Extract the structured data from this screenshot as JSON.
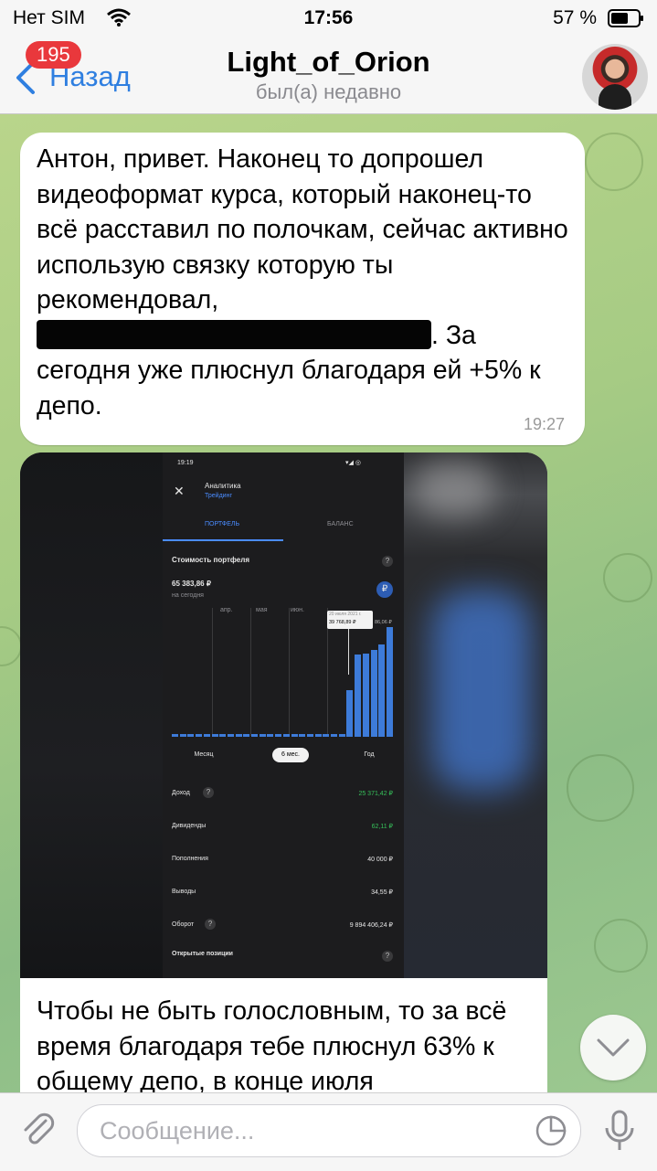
{
  "status_bar": {
    "carrier": "Нет SIM",
    "time": "17:56",
    "battery": "57 %"
  },
  "header": {
    "back_label": "Назад",
    "unread_badge": "195",
    "chat_title": "Light_of_Orion",
    "chat_status": "был(а) недавно"
  },
  "messages": [
    {
      "text_before": "Антон, привет. Наконец то допрошел видеоформат курса, который наконец-то всё расставил по полочкам, сейчас активно использую связку которую ты рекомендовал,",
      "text_after": ". За сегодня уже плюснул благодаря ей +5% к депо.",
      "time": "19:27"
    },
    {
      "caption": "Чтобы не быть голословным, то за всё время благодаря тебе плюснул 63% к общему депо, в конце июля"
    }
  ],
  "screenshot": {
    "time": "19:19",
    "title": "Аналитика",
    "subtitle": "Трейдинг",
    "tabs": [
      "ПОРТФЕЛЬ",
      "БАЛАНС"
    ],
    "section_title": "Стоимость портфеля",
    "portfolio_value": "65 383,86 ₽",
    "value_caption": "на сегодня",
    "currency_symbol": "₽",
    "month_labels": [
      "апр.",
      "мая",
      "июн."
    ],
    "tooltip_date": "20 июля 2021 г.",
    "tooltip_value": "39 768,89 ₽",
    "last_value_label": "86,06 ₽",
    "periods": [
      "Месяц",
      "6 мес.",
      "Год"
    ],
    "stats": [
      {
        "label": "Доход",
        "value": "25 371,42 ₽",
        "color": "#36c05a"
      },
      {
        "label": "Дивиденды",
        "value": "62,11 ₽",
        "color": "#36c05a"
      },
      {
        "label": "Пополнения",
        "value": "40 000 ₽",
        "color": "#e6e6e6"
      },
      {
        "label": "Выводы",
        "value": "34,55 ₽",
        "color": "#e6e6e6"
      },
      {
        "label": "Оборот",
        "value": "9 894 406,24 ₽",
        "color": "#e6e6e6"
      }
    ],
    "positions_label": "Открытые позиции"
  },
  "chart_data": {
    "type": "bar",
    "title": "Стоимость портфеля",
    "categories": [
      "апр.",
      "мая",
      "июн."
    ],
    "values": [
      1,
      1,
      1,
      1,
      1,
      1,
      1,
      1,
      1,
      1,
      1,
      1,
      1,
      1,
      1,
      1,
      1,
      1,
      1,
      1,
      1,
      1,
      16.5,
      29,
      29.5,
      30.5,
      32.6,
      38.8
    ],
    "ylim": [
      0,
      40
    ]
  },
  "input": {
    "placeholder": "Сообщение..."
  },
  "colors": {
    "accent": "#2f7fe0",
    "badge": "#e9383c",
    "chart_bar": "#3d7bd9"
  }
}
